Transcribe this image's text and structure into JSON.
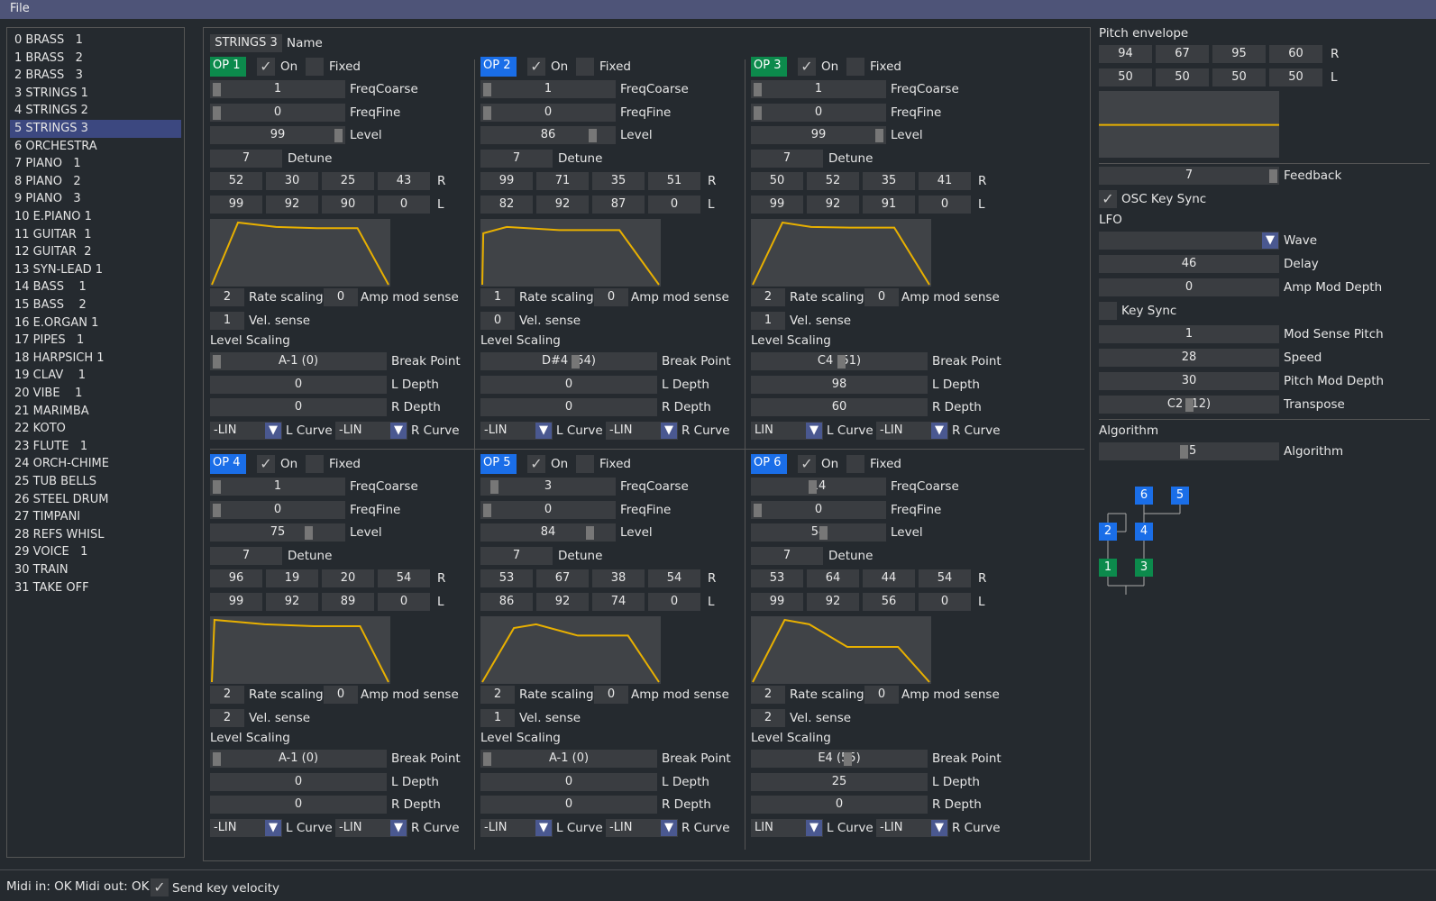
{
  "menu": {
    "file": "File"
  },
  "patches": [
    "0 BRASS   1",
    "1 BRASS   2",
    "2 BRASS   3",
    "3 STRINGS 1",
    "4 STRINGS 2",
    "5 STRINGS 3",
    "6 ORCHESTRA",
    "7 PIANO   1",
    "8 PIANO   2",
    "9 PIANO   3",
    "10 E.PIANO 1",
    "11 GUITAR  1",
    "12 GUITAR  2",
    "13 SYN-LEAD 1",
    "14 BASS    1",
    "15 BASS    2",
    "16 E.ORGAN 1",
    "17 PIPES   1",
    "18 HARPSICH 1",
    "19 CLAV    1",
    "20 VIBE    1",
    "21 MARIMBA",
    "22 KOTO",
    "23 FLUTE   1",
    "24 ORCH-CHIME",
    "25 TUB BELLS",
    "26 STEEL DRUM",
    "27 TIMPANI",
    "28 REFS WHISL",
    "29 VOICE   1",
    "30 TRAIN",
    "31 TAKE OFF"
  ],
  "selected_patch": 5,
  "name": {
    "value": "STRINGS 3",
    "label": "Name"
  },
  "labels": {
    "on": "On",
    "fixed": "Fixed",
    "freq_coarse": "FreqCoarse",
    "freq_fine": "FreqFine",
    "level": "Level",
    "detune": "Detune",
    "r": "R",
    "l": "L",
    "rate_scaling": "Rate scaling",
    "amp_mod_sense": "Amp mod sense",
    "vel_sense": "Vel. sense",
    "level_scaling": "Level Scaling",
    "break_point": "Break Point",
    "l_depth": "L Depth",
    "r_depth": "R Depth",
    "l_curve": "L Curve",
    "r_curve": "R Curve"
  },
  "ops": [
    {
      "label": "OP 1",
      "badge": "#0c8a4c",
      "on": true,
      "fixed": false,
      "freq_coarse": "1",
      "freq_coarse_v": 0,
      "freq_fine": "0",
      "freq_fine_v": 0,
      "level": "99",
      "level_v": 0.99,
      "detune": "7",
      "rates": [
        "52",
        "30",
        "25",
        "43"
      ],
      "levels": [
        "99",
        "92",
        "90",
        "0"
      ],
      "rate_scaling": "2",
      "amp_mod_sense": "0",
      "vel_sense": "1",
      "break_point": "A-1 (0)",
      "break_point_v": 0,
      "l_depth": "0",
      "r_depth": "0",
      "l_curve": "-LIN",
      "r_curve": "-LIN"
    },
    {
      "label": "OP 2",
      "badge": "#1a6ee8",
      "on": true,
      "fixed": false,
      "freq_coarse": "1",
      "freq_coarse_v": 0,
      "freq_fine": "0",
      "freq_fine_v": 0,
      "level": "86",
      "level_v": 0.86,
      "detune": "7",
      "rates": [
        "99",
        "71",
        "35",
        "51"
      ],
      "levels": [
        "82",
        "92",
        "87",
        "0"
      ],
      "rate_scaling": "1",
      "amp_mod_sense": "0",
      "vel_sense": "0",
      "break_point": "D#4 (54)",
      "break_point_v": 0.54,
      "l_depth": "0",
      "r_depth": "0",
      "l_curve": "-LIN",
      "r_curve": "-LIN"
    },
    {
      "label": "OP 3",
      "badge": "#0c8a4c",
      "on": true,
      "fixed": false,
      "freq_coarse": "1",
      "freq_coarse_v": 0,
      "freq_fine": "0",
      "freq_fine_v": 0,
      "level": "99",
      "level_v": 0.99,
      "detune": "7",
      "rates": [
        "50",
        "52",
        "35",
        "41"
      ],
      "levels": [
        "99",
        "92",
        "91",
        "0"
      ],
      "rate_scaling": "2",
      "amp_mod_sense": "0",
      "vel_sense": "1",
      "break_point": "C4 (51)",
      "break_point_v": 0.51,
      "l_depth": "98",
      "r_depth": "60",
      "l_curve": "LIN",
      "r_curve": "-LIN"
    },
    {
      "label": "OP 4",
      "badge": "#1a6ee8",
      "on": true,
      "fixed": false,
      "freq_coarse": "1",
      "freq_coarse_v": 0,
      "freq_fine": "0",
      "freq_fine_v": 0,
      "level": "75",
      "level_v": 0.75,
      "detune": "7",
      "rates": [
        "96",
        "19",
        "20",
        "54"
      ],
      "levels": [
        "99",
        "92",
        "89",
        "0"
      ],
      "rate_scaling": "2",
      "amp_mod_sense": "0",
      "vel_sense": "2",
      "break_point": "A-1 (0)",
      "break_point_v": 0,
      "l_depth": "0",
      "r_depth": "0",
      "l_curve": "-LIN",
      "r_curve": "-LIN"
    },
    {
      "label": "OP 5",
      "badge": "#1a6ee8",
      "on": true,
      "fixed": false,
      "freq_coarse": "3",
      "freq_coarse_v": 0.06,
      "freq_fine": "0",
      "freq_fine_v": 0,
      "level": "84",
      "level_v": 0.84,
      "detune": "7",
      "rates": [
        "53",
        "67",
        "38",
        "54"
      ],
      "levels": [
        "86",
        "92",
        "74",
        "0"
      ],
      "rate_scaling": "2",
      "amp_mod_sense": "0",
      "vel_sense": "1",
      "break_point": "A-1 (0)",
      "break_point_v": 0,
      "l_depth": "0",
      "r_depth": "0",
      "l_curve": "-LIN",
      "r_curve": "-LIN"
    },
    {
      "label": "OP 6",
      "badge": "#1a6ee8",
      "on": true,
      "fixed": false,
      "freq_coarse": "14",
      "freq_coarse_v": 0.45,
      "freq_fine": "0",
      "freq_fine_v": 0,
      "level": "54",
      "level_v": 0.54,
      "detune": "7",
      "rates": [
        "53",
        "64",
        "44",
        "54"
      ],
      "levels": [
        "99",
        "92",
        "56",
        "0"
      ],
      "rate_scaling": "2",
      "amp_mod_sense": "0",
      "vel_sense": "2",
      "break_point": "E4 (55)",
      "break_point_v": 0.55,
      "l_depth": "25",
      "r_depth": "0",
      "l_curve": "LIN",
      "r_curve": "-LIN"
    }
  ],
  "pitch_env": {
    "title": "Pitch envelope",
    "rates": [
      "94",
      "67",
      "95",
      "60"
    ],
    "levels": [
      "50",
      "50",
      "50",
      "50"
    ],
    "r": "R",
    "l": "L"
  },
  "feedback": {
    "value": "7",
    "label": "Feedback",
    "v": 1.0
  },
  "osc_key_sync": {
    "label": "OSC Key Sync",
    "checked": true
  },
  "lfo": {
    "title": "LFO",
    "wave_label": "Wave",
    "wave_value": "",
    "delay": "46",
    "delay_label": "Delay",
    "amp_mod_depth": "0",
    "amp_mod_depth_label": "Amp Mod Depth",
    "key_sync_label": "Key Sync",
    "key_sync": false,
    "mod_sense_pitch": "1",
    "mod_sense_pitch_label": "Mod Sense Pitch",
    "speed": "28",
    "speed_label": "Speed",
    "pitch_mod_depth": "30",
    "pitch_mod_depth_label": "Pitch Mod Depth",
    "transpose": "C2 (12)",
    "transpose_label": "Transpose",
    "transpose_v": 0.5
  },
  "algorithm": {
    "title": "Algorithm",
    "value": "15",
    "label": "Algorithm",
    "v": 0.47,
    "boxes": [
      {
        "n": "6",
        "role": "modulator"
      },
      {
        "n": "5",
        "role": "modulator"
      },
      {
        "n": "2",
        "role": "modulator"
      },
      {
        "n": "4",
        "role": "modulator"
      },
      {
        "n": "1",
        "role": "carrier"
      },
      {
        "n": "3",
        "role": "carrier"
      }
    ],
    "colors": {
      "modulator": "#1a6ee8",
      "carrier": "#0c8a4c"
    }
  },
  "status": {
    "midi_in": "Midi in: OK",
    "midi_out": "Midi out: OK",
    "send_key_velocity": "Send key velocity",
    "send_checked": true
  },
  "colors": {
    "env_line": "#e8b000",
    "accent": "#3c4880"
  }
}
